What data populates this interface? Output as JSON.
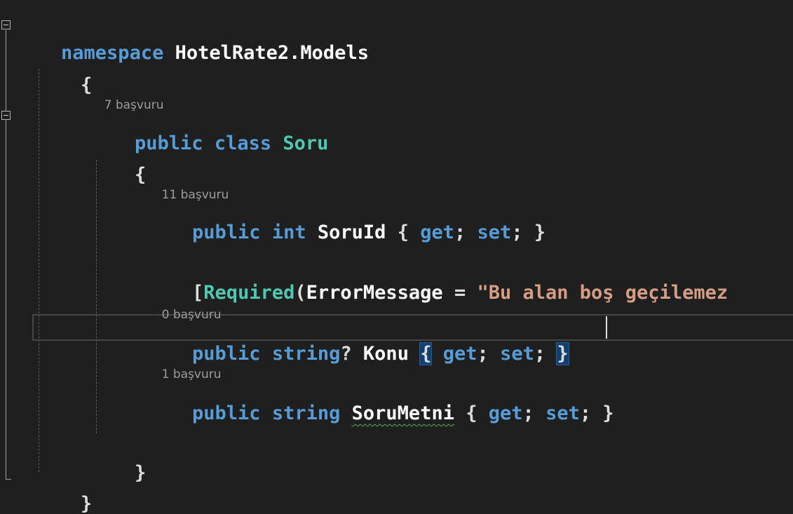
{
  "editor": {
    "lines": {
      "l1": {
        "keyword": "namespace",
        "name": "HotelRate2.Models"
      },
      "l2": {
        "brace": "{"
      },
      "l3": {
        "lens": "7 başvuru"
      },
      "l4": {
        "kw1": "public",
        "kw2": "class",
        "name": "Soru"
      },
      "l5": {
        "brace": "{"
      },
      "l6": {
        "lens": "11 başvuru"
      },
      "l7": {
        "kw1": "public",
        "kw2": "int",
        "name": "SoruId",
        "open": "{",
        "get": "get",
        "semi1": ";",
        "set": "set",
        "semi2": ";",
        "close": "}"
      },
      "l8": {
        "bracket": "[",
        "attr": "Required",
        "paren": "(",
        "param": "ErrorMessage",
        "eq": " = ",
        "str": "\"Bu alan boş geçilemez"
      },
      "l9": {
        "lens": "0 başvuru"
      },
      "l10": {
        "kw1": "public",
        "kw2": "string",
        "q": "?",
        "name": "Konu",
        "open": "{",
        "get": "get",
        "semi1": ";",
        "set": "set",
        "semi2": ";",
        "close": "}"
      },
      "l11": {
        "lens": "1 başvuru"
      },
      "l12": {
        "kw1": "public",
        "kw2": "string",
        "name": "SoruMetni",
        "open": "{",
        "get": "get",
        "semi1": ";",
        "set": "set",
        "semi2": ";",
        "close": "}"
      },
      "l13": {
        "brace": "}"
      },
      "l14": {
        "brace": "}"
      }
    },
    "colors": {
      "background": "#1f1f1f",
      "keyword": "#569cd6",
      "type": "#4ec9b0",
      "string": "#d69d85",
      "code_lens": "#9d9d9d",
      "brace_highlight": "#124070"
    }
  }
}
